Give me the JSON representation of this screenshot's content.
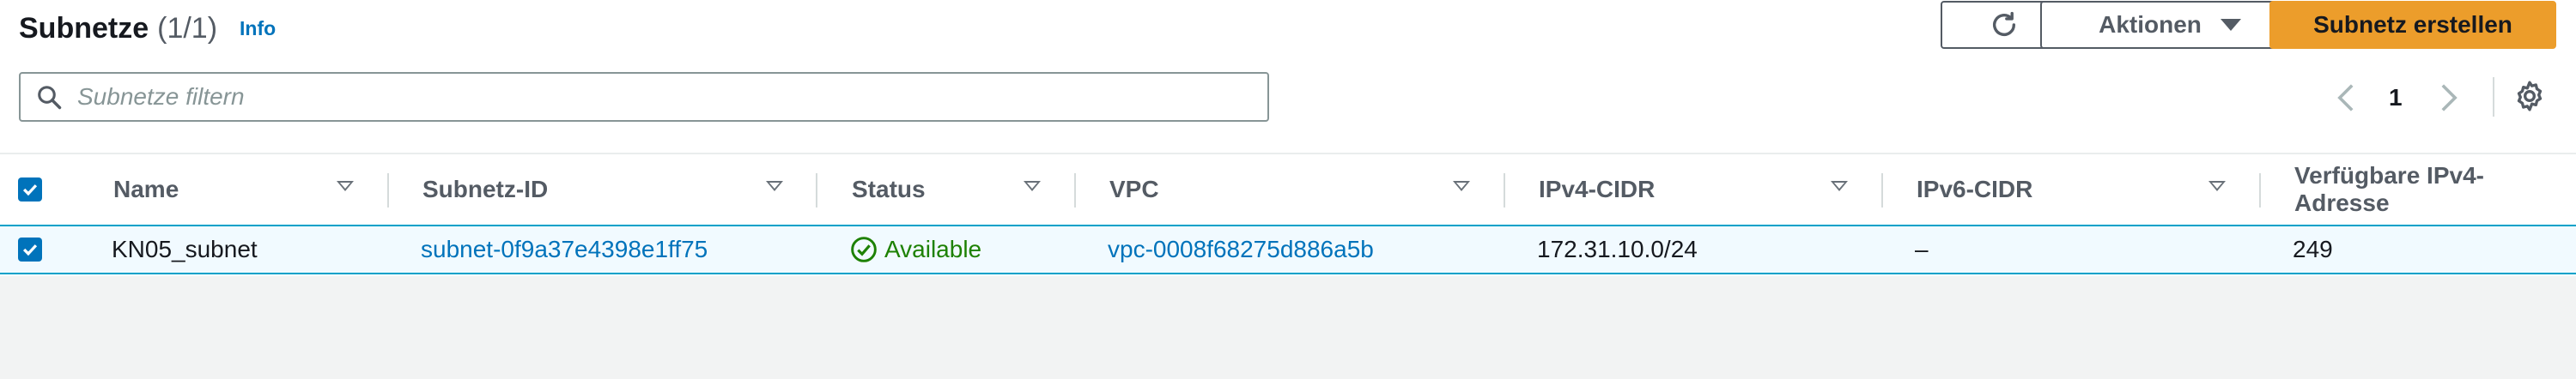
{
  "header": {
    "title": "Subnetze",
    "count": "(1/1)",
    "info_link": "Info"
  },
  "toolbar": {
    "actions_label": "Aktionen",
    "create_label": "Subnetz erstellen"
  },
  "filter": {
    "placeholder": "Subnetze filtern",
    "value": ""
  },
  "pagination": {
    "current_page": "1"
  },
  "table": {
    "columns": [
      "Name",
      "Subnetz-ID",
      "Status",
      "VPC",
      "IPv4-CIDR",
      "IPv6-CIDR",
      "Verfügbare IPv4-Adresse"
    ],
    "rows": [
      {
        "selected": true,
        "name": "KN05_subnet",
        "subnet_id": "subnet-0f9a37e4398e1ff75",
        "status": "Available",
        "vpc": "vpc-0008f68275d886a5b",
        "ipv4_cidr": "172.31.10.0/24",
        "ipv6_cidr": "–",
        "available_ipv4": "249"
      }
    ]
  },
  "colors": {
    "accent_blue": "#0073bb",
    "primary_orange": "#ec9d2b",
    "status_green": "#1d8102",
    "selected_row_bg": "#f1faff"
  },
  "icons": [
    "refresh-icon",
    "caret-down-icon",
    "search-icon",
    "chevron-left-icon",
    "chevron-right-icon",
    "gear-icon",
    "check-circle-icon",
    "checkbox-checked-icon"
  ]
}
